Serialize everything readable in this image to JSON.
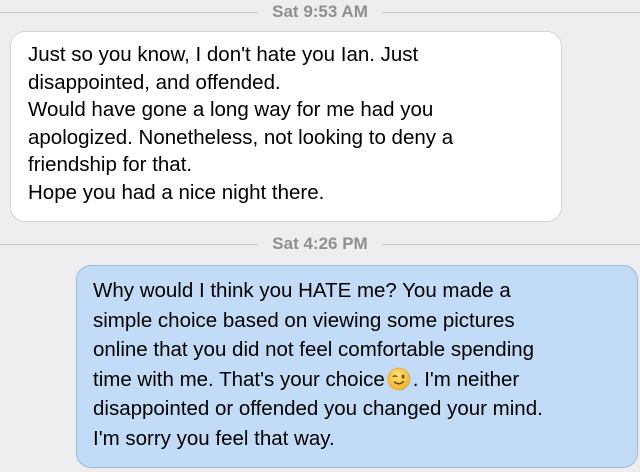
{
  "conversation": {
    "timestamps": [
      "Sat 9:53 AM",
      "Sat 4:26 PM"
    ],
    "received_message": "Just so you know, I don't hate you Ian.  Just\ndisappointed, and offended.\nWould have gone a long way for me had you\napologized. Nonetheless, not looking to deny a\nfriendship for that.\nHope you had a nice night there.",
    "sent_message": {
      "before_emoji": "Why would I think you HATE me?  You made a\nsimple choice based on viewing some pictures\nonline that you did not feel comfortable spending\ntime with me.  That's your choice",
      "emoji": "winking-face",
      "after_emoji": ". I'm neither\ndisappointed or offended you changed your mind.\nI'm sorry you feel that way."
    }
  }
}
